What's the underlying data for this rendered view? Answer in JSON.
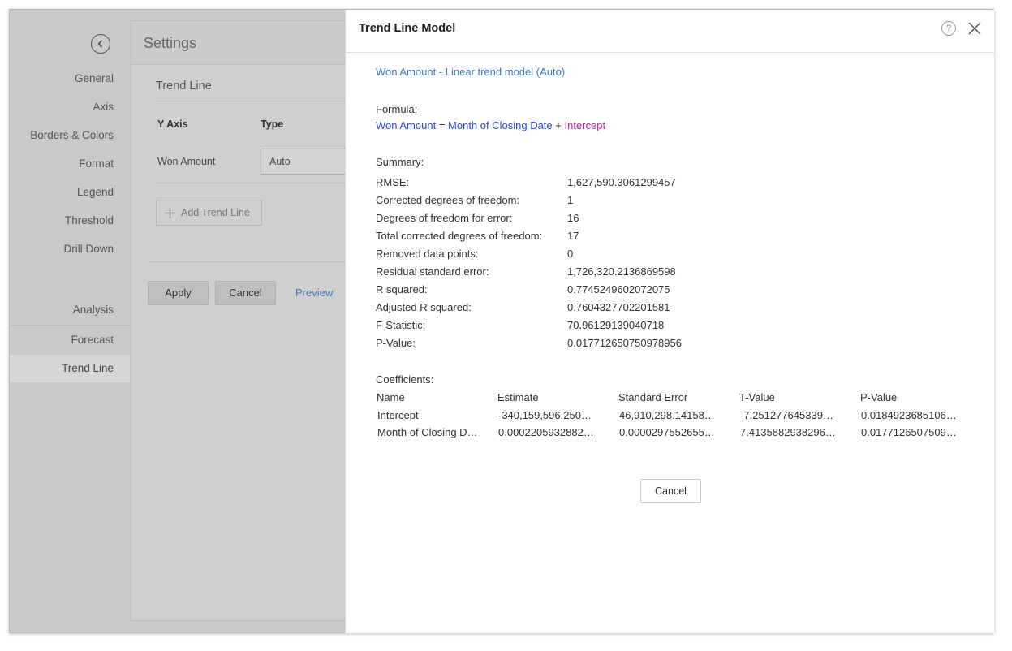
{
  "nav": {
    "items": [
      "General",
      "Axis",
      "Borders & Colors",
      "Format",
      "Legend",
      "Threshold",
      "Drill Down"
    ],
    "analysis_label": "Analysis",
    "analysis_items": [
      "Forecast",
      "Trend Line"
    ],
    "active": "Trend Line"
  },
  "settings": {
    "title": "Settings",
    "section_title": "Trend Line",
    "col_y_axis": "Y Axis",
    "col_type": "Type",
    "row_label": "Won Amount",
    "type_value": "Auto",
    "add_trend_label": "Add Trend Line",
    "apply_label": "Apply",
    "cancel_label": "Cancel",
    "preview_label": "Preview"
  },
  "modal": {
    "title": "Trend Line Model",
    "help_icon": "?",
    "model_link": "Won Amount - Linear trend model (Auto)",
    "formula_label": "Formula:",
    "formula": {
      "lhs": "Won Amount",
      "eq": " = ",
      "term": "Month of Closing Date",
      "plus": " + ",
      "intercept": "Intercept"
    },
    "summary_label": "Summary:",
    "summary": [
      {
        "key": "RMSE:",
        "value": "1,627,590.3061299457"
      },
      {
        "key": "Corrected degrees of freedom:",
        "value": "1"
      },
      {
        "key": "Degrees of freedom for error:",
        "value": "16"
      },
      {
        "key": "Total corrected degrees of freedom:",
        "value": "17"
      },
      {
        "key": "Removed data points:",
        "value": "0"
      },
      {
        "key": "Residual standard error:",
        "value": "1,726,320.2136869598"
      },
      {
        "key": "R squared:",
        "value": "0.7745249602072075"
      },
      {
        "key": "Adjusted R squared:",
        "value": "0.7604327702201581"
      },
      {
        "key": "F-Statistic:",
        "value": "70.96129139040718"
      },
      {
        "key": "P-Value:",
        "value": "0.017712650750978956"
      }
    ],
    "coefficients_label": "Coefficients:",
    "coefficients": {
      "headers": [
        "Name",
        "Estimate",
        "Standard Error",
        "T-Value",
        "P-Value"
      ],
      "rows": [
        [
          "Intercept",
          "-340,159,596.250…",
          "46,910,298.14158…",
          "-7.251277645339…",
          "0.0184923685106…"
        ],
        [
          "Month of Closing D…",
          "0.0002205932882…",
          "0.0000297552655…",
          "7.4135882938296…",
          "0.0177126507509…"
        ]
      ]
    },
    "cancel_label": "Cancel"
  }
}
